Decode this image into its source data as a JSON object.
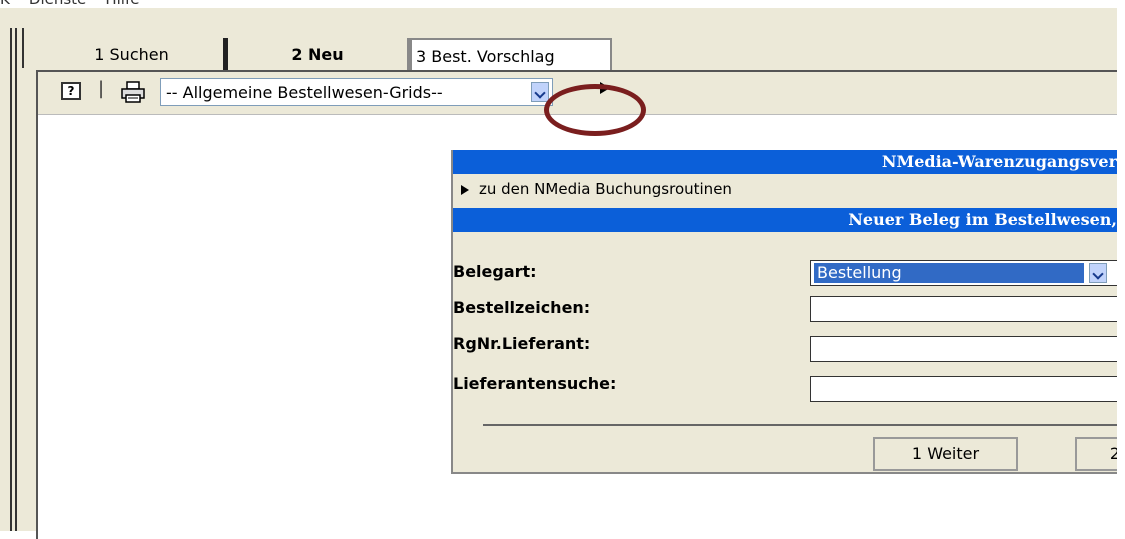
{
  "menu": {
    "text": "K    Dienste    Hilfe"
  },
  "tabs": [
    {
      "label": "1 Suchen"
    },
    {
      "label": "2 Neu"
    },
    {
      "label": "3 Best. Vorschlag"
    }
  ],
  "toolbar": {
    "help_icon": "?",
    "separator": "|",
    "grid_select": {
      "value": "-- Allgemeine Bestellwesen-Grids--"
    }
  },
  "dialog": {
    "title": "NMedia-Warenzugangsver",
    "link": "zu den NMedia Buchungsroutinen",
    "subtitle": "Neuer Beleg im Bestellwesen,",
    "fields": [
      {
        "label": "Belegart:",
        "value": "Bestellung"
      },
      {
        "label": "Bestellzeichen:",
        "value": ""
      },
      {
        "label": "RgNr.Lieferant:",
        "value": ""
      },
      {
        "label": "Lieferantensuche:",
        "value": ""
      }
    ],
    "buttons": {
      "next": "1 Weiter",
      "second": "2"
    }
  },
  "colors": {
    "header_blue": "#0b5fd9",
    "selection_blue": "#316ac5",
    "highlight_circle": "#7a1e1e",
    "panel_beige": "#ece9d8"
  }
}
